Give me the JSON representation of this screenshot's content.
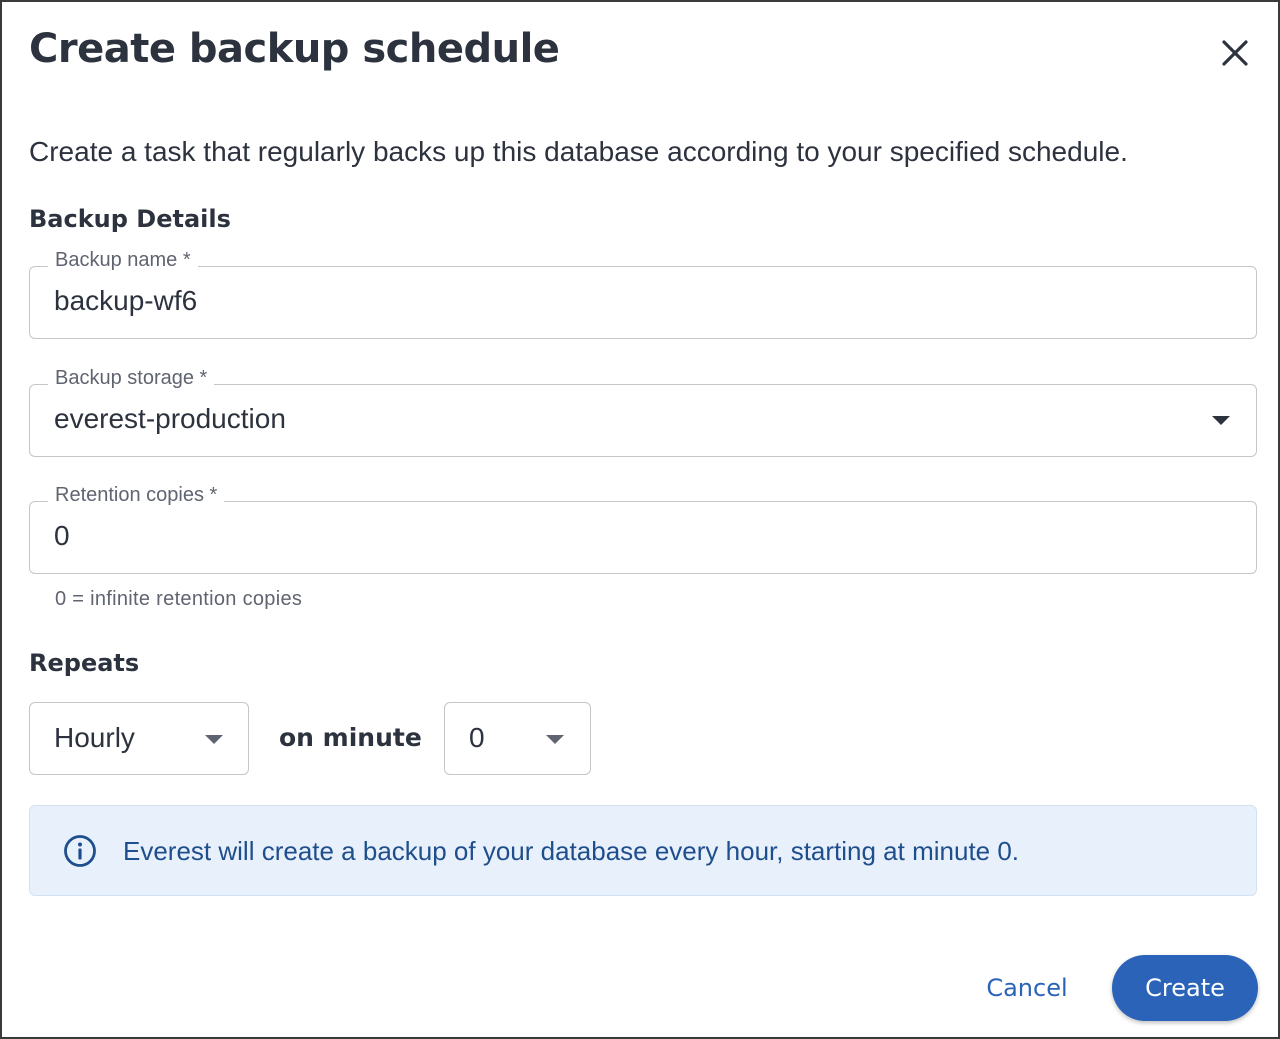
{
  "dialog": {
    "title": "Create backup schedule",
    "description": "Create a task that regularly backs up this database according to your specified schedule."
  },
  "backup_details": {
    "heading": "Backup Details",
    "backup_name": {
      "label": "Backup name *",
      "value": "backup-wf6"
    },
    "backup_storage": {
      "label": "Backup storage *",
      "value": "everest-production"
    },
    "retention_copies": {
      "label": "Retention copies *",
      "value": "0",
      "helper": "0 = infinite retention copies"
    }
  },
  "repeats": {
    "heading": "Repeats",
    "frequency": {
      "value": "Hourly"
    },
    "on_minute_label": "on minute",
    "minute": {
      "value": "0"
    }
  },
  "info_alert": {
    "icon": "info-icon",
    "message": "Everest will create a backup of your database every hour, starting at minute 0."
  },
  "actions": {
    "cancel_label": "Cancel",
    "create_label": "Create"
  },
  "colors": {
    "primary": "#2a63b8",
    "alert_background": "#e8f1fb",
    "alert_text": "#1f4e8c",
    "text": "#2c323e"
  }
}
